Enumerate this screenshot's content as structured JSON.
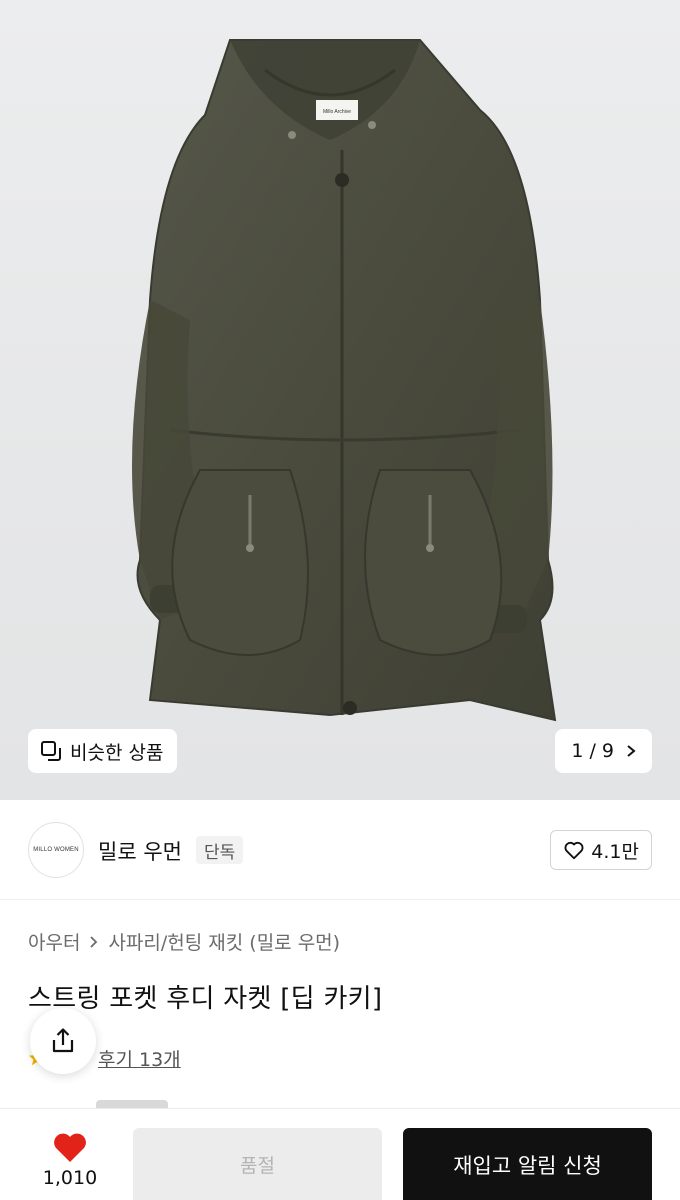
{
  "gallery": {
    "similar_label": "비슷한 상품",
    "page_indicator": "1 / 9",
    "tag_text": "Millo Archive"
  },
  "brand": {
    "logo_text": "MILLO WOMEN",
    "name": "밀로 우먼",
    "badge": "단독",
    "likes": "4.1만"
  },
  "product": {
    "breadcrumb": [
      "아우터",
      "사파리/헌팅 재킷 (밀로 우먼)"
    ],
    "title": "스트링 포켓 후디 자켓 [딥 카키]",
    "review_link": "후기 13개"
  },
  "bottom_bar": {
    "wish_count": "1,010",
    "soldout_label": "품절",
    "restock_label": "재입고 알림 신청"
  },
  "colors": {
    "jacket": "#4d4d3e",
    "heart": "#e2231a",
    "primary_button": "#111111"
  },
  "icons": [
    "similar-items-icon",
    "chevron-right-icon",
    "heart-outline-icon",
    "share-icon",
    "star-icon",
    "heart-filled-icon"
  ]
}
